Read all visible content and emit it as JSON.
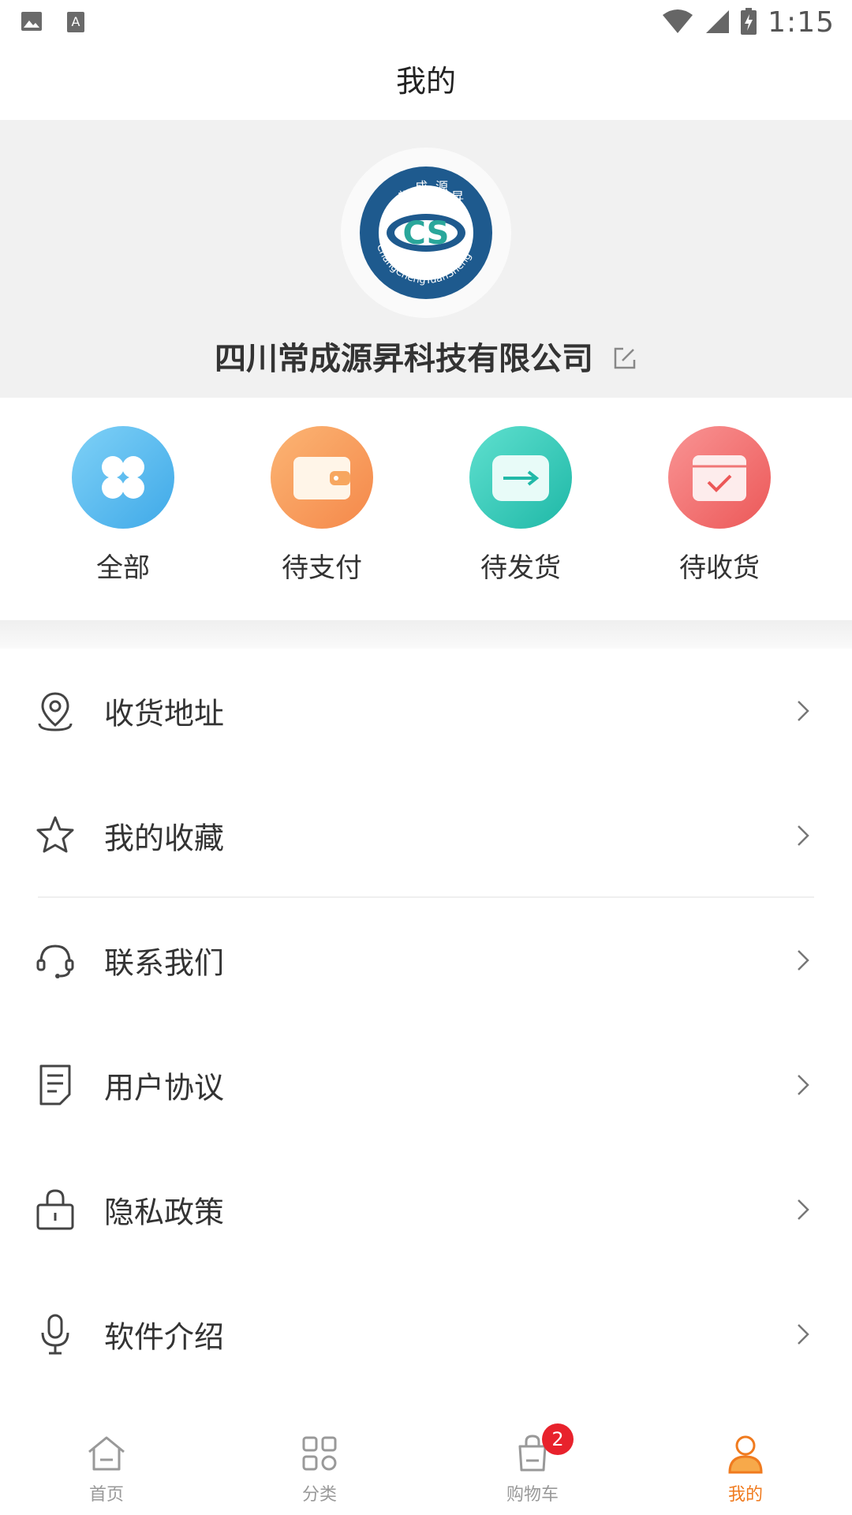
{
  "status_bar": {
    "time": "1:15"
  },
  "header": {
    "title": "我的"
  },
  "profile": {
    "company_name": "四川常成源昇科技有限公司",
    "logo_top_text": [
      "常",
      "成",
      "源",
      "昇"
    ],
    "logo_ring_text": "ChangChengYuanSheng",
    "logo_center_text": "CS"
  },
  "orders": [
    {
      "label": "全部",
      "icon": "grid-icon",
      "color": "#5bbdf0"
    },
    {
      "label": "待支付",
      "icon": "wallet-icon",
      "color": "#f89a4f"
    },
    {
      "label": "待发货",
      "icon": "ship-icon",
      "color": "#2fc8b8"
    },
    {
      "label": "待收货",
      "icon": "receive-icon",
      "color": "#f06a6a"
    }
  ],
  "menu": [
    {
      "label": "收货地址",
      "icon": "location-pin-icon"
    },
    {
      "label": "我的收藏",
      "icon": "star-icon"
    },
    {
      "label": "联系我们",
      "icon": "headset-icon"
    },
    {
      "label": "用户协议",
      "icon": "document-icon"
    },
    {
      "label": "隐私政策",
      "icon": "lock-icon"
    },
    {
      "label": "软件介绍",
      "icon": "microphone-icon"
    }
  ],
  "tabbar": {
    "tabs": [
      {
        "label": "首页",
        "icon": "home-icon"
      },
      {
        "label": "分类",
        "icon": "category-icon"
      },
      {
        "label": "购物车",
        "icon": "cart-bag-icon",
        "badge": "2"
      },
      {
        "label": "我的",
        "icon": "user-icon",
        "active": true
      }
    ],
    "active_color": "#f07b1f"
  }
}
